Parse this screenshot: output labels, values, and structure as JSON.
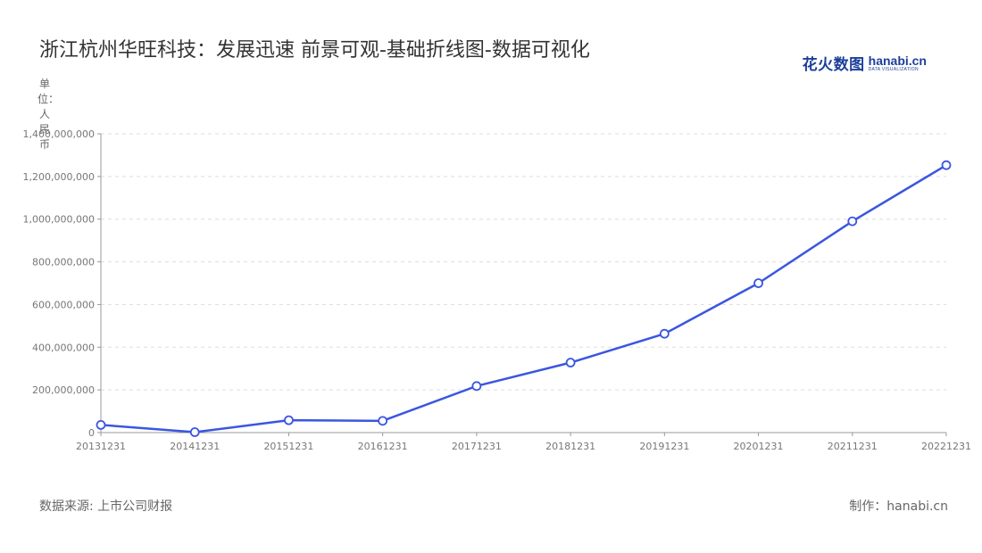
{
  "header": {
    "title": "浙江杭州华旺科技：发展迅速 前景可观-基础折线图-数据可视化"
  },
  "brand": {
    "cn": "花火数图",
    "en": "hanabi.cn",
    "sub": "DATA VISUALIZATION",
    "color": "#1d3f9a"
  },
  "footer": {
    "source": "数据来源: 上市公司财报",
    "maker": "制作：hanabi.cn"
  },
  "chart_data": {
    "type": "line",
    "title": "浙江杭州华旺科技：发展迅速 前景可观-基础折线图-数据可视化",
    "ylabel": "单位：人民币",
    "xlabel": "",
    "categories": [
      "20131231",
      "20141231",
      "20151231",
      "20161231",
      "20171231",
      "20181231",
      "20191231",
      "20201231",
      "20211231",
      "20221231"
    ],
    "series": [
      {
        "values": [
          36000000,
          2000000,
          58000000,
          55000000,
          218000000,
          328000000,
          463000000,
          700000000,
          990000000,
          1253000000
        ],
        "color": "#3b56e0"
      }
    ],
    "ylim": [
      0,
      1400000000
    ],
    "yticks": [
      0,
      200000000,
      400000000,
      600000000,
      800000000,
      1000000000,
      1200000000,
      1400000000
    ],
    "ytick_labels": [
      "0",
      "200,000,000",
      "400,000,000",
      "600,000,000",
      "800,000,000",
      "1,000,000,000",
      "1,200,000,000",
      "1,400,000,000"
    ],
    "grid": true,
    "legend": "none"
  }
}
